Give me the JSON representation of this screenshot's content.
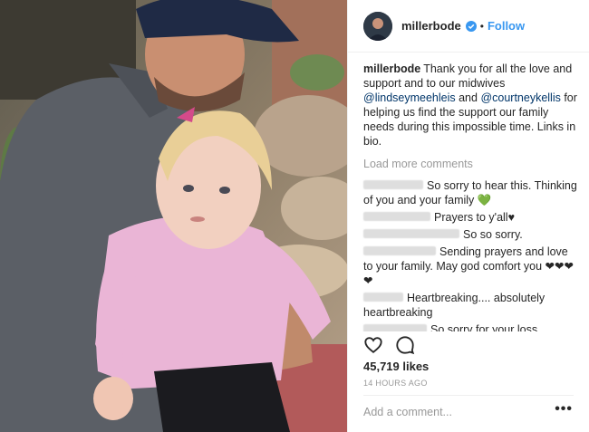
{
  "post": {
    "header": {
      "username": "millerbode",
      "separator": "•",
      "follow_label": "Follow"
    },
    "caption": {
      "username": "millerbode",
      "text_1": "Thank you for all the love and support and to our midwives ",
      "mention_1": "@lindseymeehleis",
      "text_2": " and ",
      "mention_2": "@courtneykellis",
      "text_3": " for helping us find the support our family needs during this impossible time. Links in bio."
    },
    "load_more_label": "Load more comments",
    "comments": [
      {
        "text": "So sorry to hear this. Thinking of you and your family ",
        "emoji": "💚"
      },
      {
        "text": "Prayers to y'all",
        "emoji": "♥"
      },
      {
        "text": "So so sorry.",
        "emoji": ""
      },
      {
        "text": "Sending prayers and love to your family. May god comfort you ",
        "emoji": "❤❤❤❤"
      },
      {
        "text": "Heartbreaking.... absolutely heartbreaking",
        "emoji": ""
      },
      {
        "text": "So sorry for your loss",
        "emoji": ""
      },
      {
        "text": "",
        "emoji": "❤🙏😢"
      }
    ],
    "likes": "45,719 likes",
    "timestamp": "14 HOURS AGO",
    "add_comment_placeholder": "Add a comment...",
    "more_options": "•••",
    "icons": {
      "like": "heart-outline-icon",
      "comment": "speech-bubble-icon",
      "verified": "verified-badge-icon",
      "more": "ellipsis-icon"
    },
    "colors": {
      "link_blue": "#3897f0",
      "mention_blue": "#003569",
      "muted_gray": "#999999",
      "text": "#262626"
    }
  }
}
